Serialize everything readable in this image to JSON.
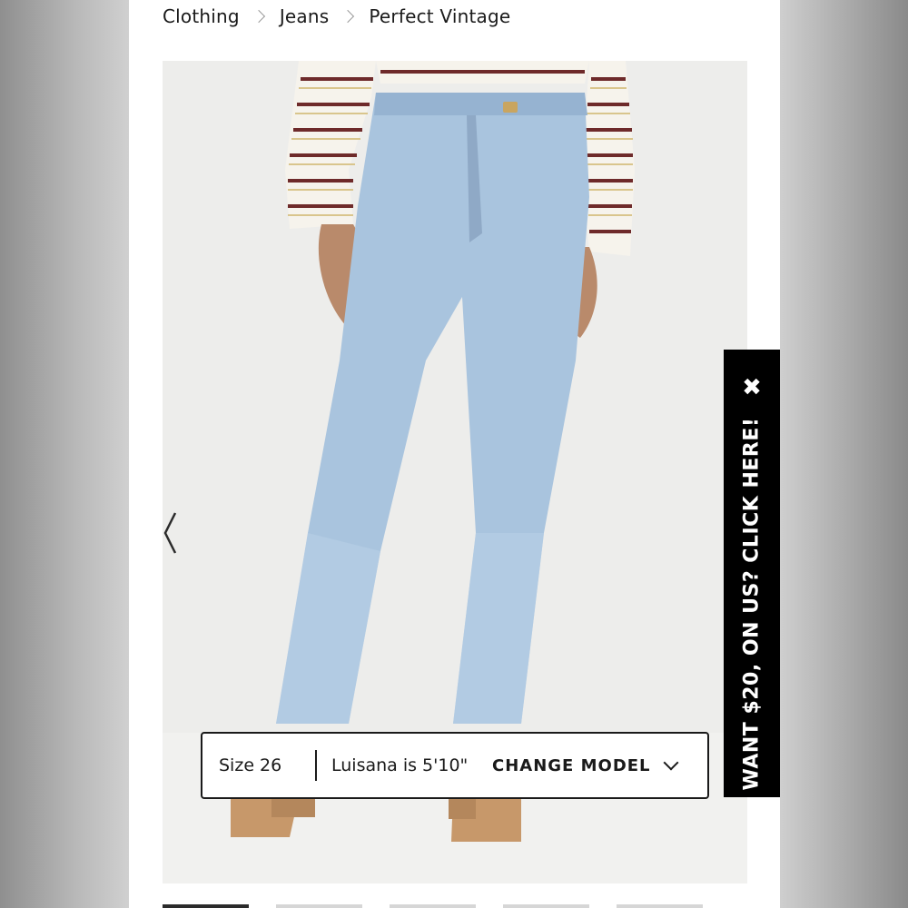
{
  "breadcrumb": {
    "items": [
      "Clothing",
      "Jeans",
      "Perfect Vintage"
    ]
  },
  "product_image": {
    "alt_icon": "product-photo",
    "prev_icon": "chevron-left-icon"
  },
  "model_info": {
    "size": "Size 26",
    "model_height": "Luisana is 5'10\"",
    "change_label": "CHANGE MODEL",
    "change_icon": "chevron-down-icon"
  },
  "promo": {
    "text": "WANT $20, ON US? CLICK HERE!",
    "close_glyph": "✖",
    "background": "#000000",
    "color": "#ffffff"
  },
  "gallery": {
    "thumbnail_count": 5,
    "active_index": 0
  }
}
